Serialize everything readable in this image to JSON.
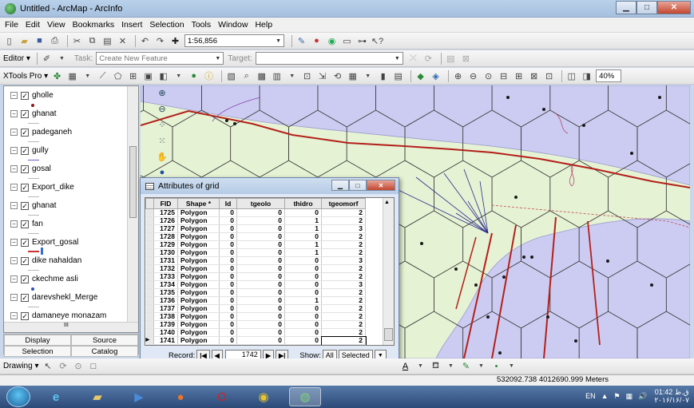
{
  "window": {
    "title": "Untitled - ArcMap - ArcInfo",
    "minimize": "▁",
    "maximize": "□",
    "close": "✕"
  },
  "menu": [
    "File",
    "Edit",
    "View",
    "Bookmarks",
    "Insert",
    "Selection",
    "Tools",
    "Window",
    "Help"
  ],
  "standard_toolbar": {
    "scale": "1:56,856"
  },
  "editor_toolbar": {
    "editor_label": "Editor ▾",
    "task_label": "Task:",
    "task_value": "Create New Feature",
    "target_label": "Target:",
    "target_value": ""
  },
  "xtools_toolbar": {
    "label": "XTools Pro ▾",
    "zoom_value": "40%"
  },
  "toc": {
    "layers": [
      {
        "name": "gholle",
        "symbol": "dot",
        "color": "#8b1a1a"
      },
      {
        "name": "ghanat",
        "symbol": "line",
        "color": "#b8b8b8"
      },
      {
        "name": "padeganeh",
        "symbol": "line",
        "color": "#b8b8b8"
      },
      {
        "name": "gully",
        "symbol": "line",
        "color": "#7a5cc9"
      },
      {
        "name": "gosal",
        "symbol": "line",
        "color": "#b8b8b8"
      },
      {
        "name": "Export_dike",
        "symbol": "line",
        "color": "#b8b8b8"
      },
      {
        "name": "ghanat",
        "symbol": "line",
        "color": "#b8b8b8"
      },
      {
        "name": "fan",
        "symbol": "line",
        "color": "#b8b8b8"
      },
      {
        "name": "Export_gosal",
        "symbol": "bar",
        "color": "#2f6fd6"
      },
      {
        "name": "dike nahaldan",
        "symbol": "line",
        "color": "#b8b8b8"
      },
      {
        "name": "ckechme asli",
        "symbol": "dot",
        "color": "#2f4fb0"
      },
      {
        "name": "darevshekl_Merge",
        "symbol": "line",
        "color": "#b8b8b8"
      },
      {
        "name": "damaneye monazam",
        "symbol": "line",
        "color": "#b8b8b8"
      }
    ],
    "scroll_mark": "III",
    "tabs": [
      "Display",
      "Source",
      "Selection",
      "Catalog"
    ]
  },
  "attributes": {
    "title": "Attributes of grid",
    "columns": [
      "FID",
      "Shape *",
      "Id",
      "tgeolo",
      "thidro",
      "tgeomorf"
    ],
    "rows": [
      [
        "1725",
        "Polygon",
        "0",
        "0",
        "0",
        "2"
      ],
      [
        "1726",
        "Polygon",
        "0",
        "0",
        "1",
        "2"
      ],
      [
        "1727",
        "Polygon",
        "0",
        "0",
        "1",
        "3"
      ],
      [
        "1728",
        "Polygon",
        "0",
        "0",
        "0",
        "2"
      ],
      [
        "1729",
        "Polygon",
        "0",
        "0",
        "1",
        "2"
      ],
      [
        "1730",
        "Polygon",
        "0",
        "0",
        "1",
        "2"
      ],
      [
        "1731",
        "Polygon",
        "0",
        "0",
        "0",
        "3"
      ],
      [
        "1732",
        "Polygon",
        "0",
        "0",
        "0",
        "2"
      ],
      [
        "1733",
        "Polygon",
        "0",
        "0",
        "0",
        "2"
      ],
      [
        "1734",
        "Polygon",
        "0",
        "0",
        "0",
        "3"
      ],
      [
        "1735",
        "Polygon",
        "0",
        "0",
        "0",
        "2"
      ],
      [
        "1736",
        "Polygon",
        "0",
        "0",
        "1",
        "2"
      ],
      [
        "1737",
        "Polygon",
        "0",
        "0",
        "0",
        "2"
      ],
      [
        "1738",
        "Polygon",
        "0",
        "0",
        "0",
        "2"
      ],
      [
        "1739",
        "Polygon",
        "0",
        "0",
        "0",
        "2"
      ],
      [
        "1740",
        "Polygon",
        "0",
        "0",
        "0",
        "2"
      ],
      [
        "1741",
        "Polygon",
        "0",
        "0",
        "0",
        "2"
      ]
    ],
    "current_row_marker": "▶",
    "record_label": "Record:",
    "record_value": "1742",
    "show_label": "Show:",
    "show_all": "All",
    "show_selected": "Selected"
  },
  "draw_toolbar": {
    "label": "Drawing ▾"
  },
  "status": {
    "coords": "532092.738  4012690.999 Meters"
  },
  "tray": {
    "lang": "EN",
    "time": "01:42 ق.ظ",
    "date": "۲۰۱۶/۱۶/۰۷"
  },
  "colors": {
    "hex_fill": "#ccccf2",
    "terrain": "#e6f2d4",
    "fault_line": "#b3201a",
    "dot": "#8b1a1a"
  }
}
